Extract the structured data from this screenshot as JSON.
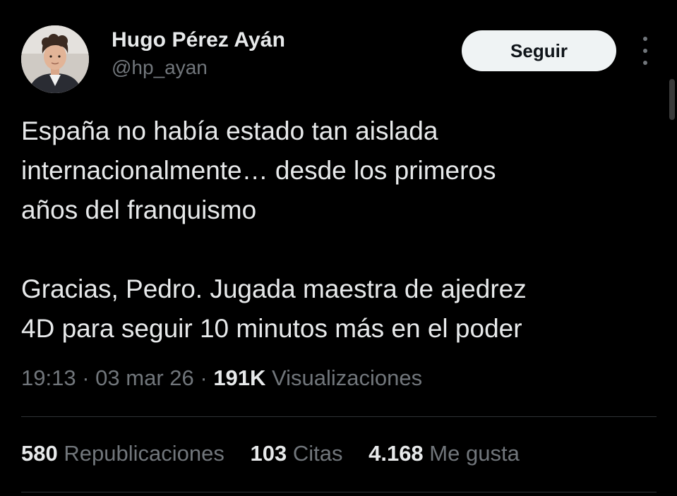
{
  "author": {
    "display_name": "Hugo Pérez Ayán",
    "handle": "@hp_ayan",
    "avatar_icon": "profile-photo"
  },
  "actions": {
    "follow_label": "Seguir",
    "more_icon": "three-dots-vertical"
  },
  "tweet": {
    "paragraph1": [
      "España no había estado tan aislada",
      "internacionalmente… desde los primeros",
      "años del franquismo"
    ],
    "paragraph2": [
      "Gracias, Pedro. Jugada maestra de ajedrez",
      "4D para seguir 10 minutos más en el poder"
    ]
  },
  "meta": {
    "time": "19:13",
    "date": "03 mar 26",
    "separator": "·",
    "views_count": "191K",
    "views_label": "Visualizaciones"
  },
  "stats": {
    "reposts_count": "580",
    "reposts_label": "Republicaciones",
    "quotes_count": "103",
    "quotes_label": "Citas",
    "likes_count": "4.168",
    "likes_label": "Me gusta"
  },
  "colors": {
    "background": "#000000",
    "primary_text": "#e7e9ea",
    "secondary_text": "#71767b",
    "button_bg": "#eff3f4",
    "divider": "#2f3336"
  }
}
